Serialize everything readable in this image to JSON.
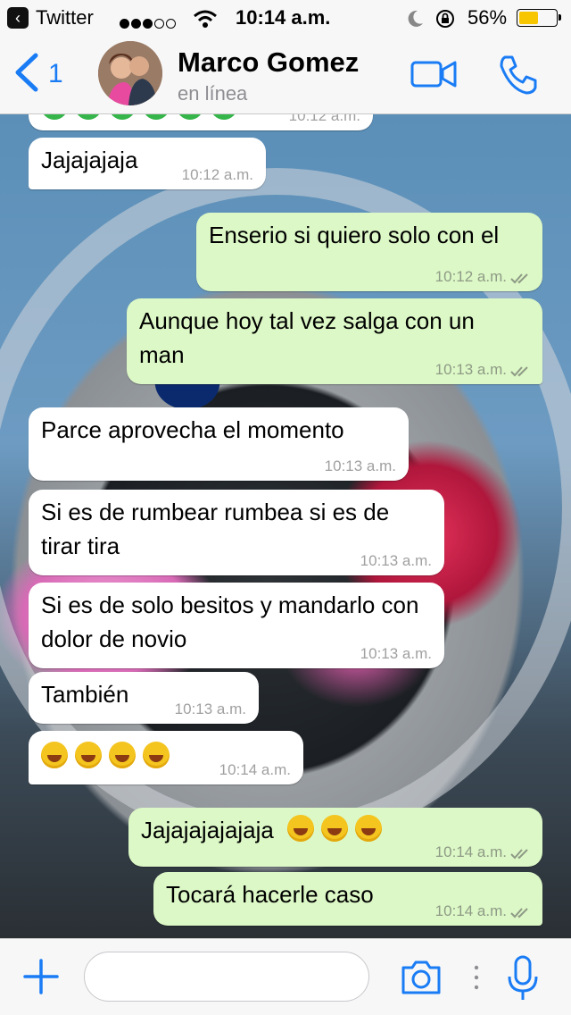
{
  "status_bar": {
    "back_app": "Twitter",
    "time": "10:14 a.m.",
    "battery_percent": "56%",
    "battery_level": 0.56,
    "signal_bars_filled": 3,
    "signal_bars_total": 5
  },
  "header": {
    "back_count": "1",
    "contact_name": "Marco Gomez",
    "contact_status": "en línea"
  },
  "messages": [
    {
      "dir": "in",
      "text": "",
      "time": "10:12 a.m.",
      "partial": true
    },
    {
      "dir": "in",
      "text": "Jajajajaja",
      "time": "10:12 a.m."
    },
    {
      "dir": "out",
      "text": "Enserio si quiero solo con el",
      "time": "10:12 a.m.",
      "read": true
    },
    {
      "dir": "out",
      "text": "Aunque hoy tal vez salga con un man",
      "time": "10:13 a.m.",
      "read": true
    },
    {
      "dir": "in",
      "text": "Parce aprovecha el momento",
      "time": "10:13 a.m."
    },
    {
      "dir": "in",
      "text": "Si es de rumbear rumbea si es de tirar tira",
      "time": "10:13 a.m."
    },
    {
      "dir": "in",
      "text": "Si es de solo besitos y mandarlo con dolor de novio",
      "time": "10:13 a.m."
    },
    {
      "dir": "in",
      "text": "También",
      "time": "10:13 a.m."
    },
    {
      "dir": "in",
      "text": "",
      "emoji_count": 4,
      "time": "10:14 a.m."
    },
    {
      "dir": "out",
      "text": "Jajajajajajaja",
      "emoji_count": 3,
      "time": "10:14 a.m.",
      "read": true
    },
    {
      "dir": "out",
      "text": "Tocará hacerle caso",
      "time": "10:14 a.m.",
      "read": true
    }
  ],
  "input": {
    "placeholder": ""
  },
  "colors": {
    "accent": "#1a7cf5",
    "incoming_bubble": "#ffffff",
    "outgoing_bubble": "#dcf8c6",
    "battery": "#f7c600"
  },
  "icons": {
    "back": "chevron-left-icon",
    "video": "video-camera-icon",
    "phone": "phone-icon",
    "plus": "plus-icon",
    "camera": "camera-icon",
    "mic": "microphone-icon",
    "read_receipt": "double-check-icon",
    "emoji": "rolling-on-floor-laughing-emoji"
  }
}
